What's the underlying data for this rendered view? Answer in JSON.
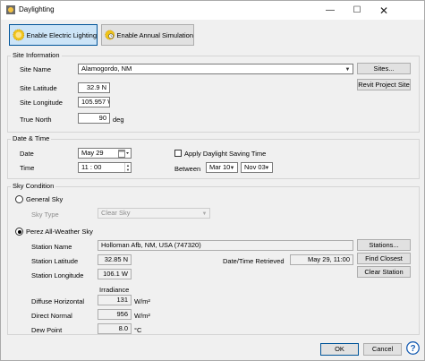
{
  "window": {
    "title": "Daylighting"
  },
  "toolbar": {
    "electric_label": "Enable Electric Lighting",
    "annual_label": "Enable Annual Simulation"
  },
  "site": {
    "group_label": "Site Information",
    "name_label": "Site Name",
    "name_value": "Alamogordo, NM",
    "sites_button": "Sites...",
    "lat_label": "Site Latitude",
    "lat_value": "32.9 N",
    "lon_label": "Site Longitude",
    "lon_value": "105.957 W",
    "revit_button": "Revit Project Site",
    "north_label": "True North",
    "north_value": "90",
    "north_unit": "deg"
  },
  "datetime": {
    "group_label": "Date & Time",
    "date_label": "Date",
    "date_value": "May 29",
    "time_label": "Time",
    "time_value": "11 : 00",
    "dst_label": "Apply Daylight Saving Time",
    "between_label": "Between",
    "dst_start": "Mar 10",
    "dst_end": "Nov 03"
  },
  "sky": {
    "group_label": "Sky Condition",
    "general_label": "General Sky",
    "skytype_label": "Sky Type",
    "skytype_value": "Clear Sky",
    "perez_label": "Perez All-Weather Sky",
    "station_name_label": "Station Name",
    "station_name_value": "Holloman Afb, NM, USA (747320)",
    "stations_button": "Stations...",
    "station_lat_label": "Station Latitude",
    "station_lat_value": "32.85 N",
    "datetime_retrieved_label": "Date/Time Retrieved",
    "datetime_retrieved_value": "May 29, 11:00",
    "find_closest_button": "Find Closest",
    "station_lon_label": "Station Longitude",
    "station_lon_value": "106.1 W",
    "clear_station_button": "Clear Station",
    "irradiance_label": "Irradiance",
    "diffuse_label": "Diffuse Horizontal",
    "diffuse_value": "131",
    "diffuse_unit": "W/m²",
    "direct_label": "Direct Normal",
    "direct_value": "956",
    "direct_unit": "W/m²",
    "dew_label": "Dew Point",
    "dew_value": "8.0",
    "dew_unit": "°C"
  },
  "footer": {
    "ok": "OK",
    "cancel": "Cancel"
  },
  "colors": {
    "accent": "#005499",
    "active_bg": "#cce4f7",
    "help": "#1a5fb4"
  },
  "icons": [
    "app-icon",
    "minimize-icon",
    "maximize-icon",
    "close-icon",
    "sun-icon",
    "sun-clock-icon",
    "calendar-icon",
    "help-icon"
  ]
}
